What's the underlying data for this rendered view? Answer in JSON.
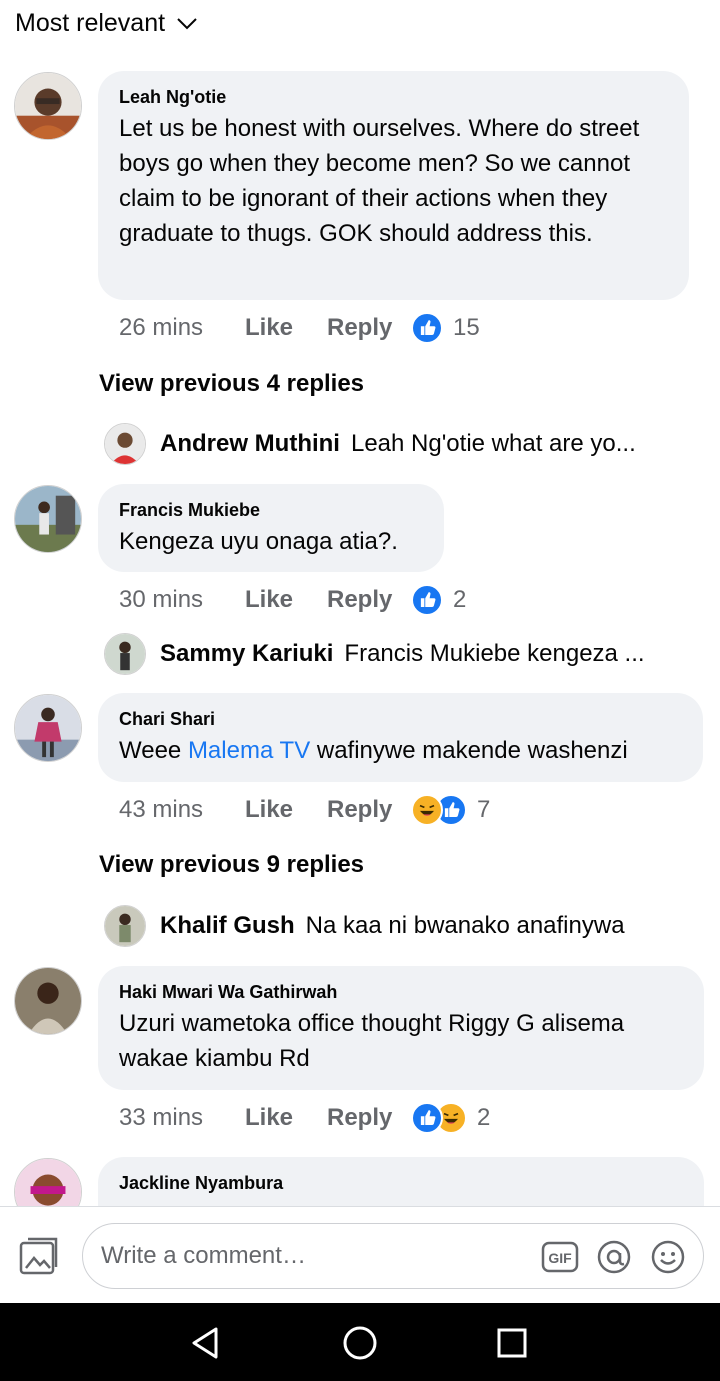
{
  "sort": {
    "label": "Most relevant"
  },
  "comments": [
    {
      "author": "Leah Ng'otie",
      "text": "Let us be honest with ourselves. Where do street boys go when they become men? So we cannot claim to be ignorant of their actions when they graduate to thugs. GOK should address this.",
      "time": "26 mins",
      "like": "Like",
      "reply": "Reply",
      "reaction_count": "15",
      "reactions": [
        "like"
      ],
      "view_previous": "View previous 4 replies",
      "reply_preview": {
        "name": "Andrew Muthini",
        "text": "Leah Ng'otie what are yo..."
      }
    },
    {
      "author": "Francis Mukiebe",
      "text": "Kengeza uyu onaga atia?.",
      "time": "30 mins",
      "like": "Like",
      "reply": "Reply",
      "reaction_count": "2",
      "reactions": [
        "like"
      ],
      "reply_preview": {
        "name": "Sammy Kariuki",
        "text": "Francis Mukiebe kengeza ..."
      }
    },
    {
      "author": "Chari Shari",
      "text_prefix": "Weee ",
      "mention": "Malema TV",
      "text_suffix": " wafinywe makende washenzi",
      "time": "43 mins",
      "like": "Like",
      "reply": "Reply",
      "reaction_count": "7",
      "reactions": [
        "haha",
        "like"
      ],
      "view_previous": "View previous 9 replies",
      "reply_preview": {
        "name": "Khalif Gush",
        "text": "Na kaa ni bwanako anafinywa"
      }
    },
    {
      "author": "Haki Mwari Wa Gathirwah",
      "text": "Uzuri wametoka office thought Riggy G alisema wakae kiambu Rd",
      "time": "33 mins",
      "like": "Like",
      "reply": "Reply",
      "reaction_count": "2",
      "reactions": [
        "like",
        "haha"
      ]
    },
    {
      "author": "Jackline Nyambura",
      "text": ""
    }
  ],
  "composer": {
    "placeholder": "Write a comment…",
    "gif_label": "GIF"
  },
  "colors": {
    "accent": "#1877f2",
    "bubble": "#f0f2f5",
    "meta_text": "#65676b",
    "haha": "#f7b125"
  },
  "icons": [
    "chevron-down-icon",
    "photo-icon",
    "gif-icon",
    "mention-icon",
    "emoji-icon",
    "back-icon",
    "home-icon",
    "recents-icon"
  ]
}
